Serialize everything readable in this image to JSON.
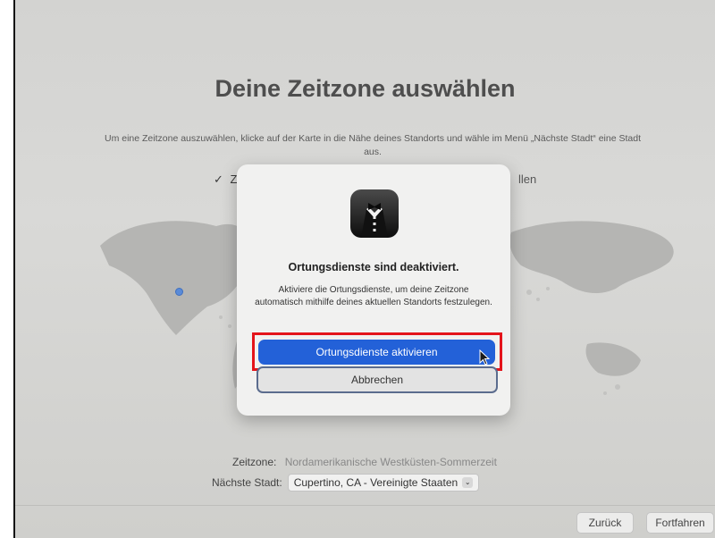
{
  "screen": {
    "title": "Deine Zeitzone auswählen",
    "subtitle": "Um eine Zeitzone auszuwählen, klicke auf der Karte in die Nähe deines Standorts und wähle im Menü „Nächste Stadt“ eine Stadt aus.",
    "auto_checkbox": {
      "checkmark": "✓",
      "visible_start": "Z",
      "visible_end": "llen"
    }
  },
  "dialog": {
    "icon": "butler-tuxedo-icon",
    "title": "Ortungsdienste sind deaktiviert.",
    "message": "Aktiviere die Ortungsdienste, um deine Zeitzone automatisch mithilfe deines aktuellen Standorts festzulegen.",
    "primary_button": "Ortungsdienste aktivieren",
    "secondary_button": "Abbrechen"
  },
  "timezone": {
    "label": "Zeitzone:",
    "value": "Nordamerikanische Westküsten-Sommerzeit"
  },
  "city": {
    "label": "Nächste Stadt:",
    "value": "Cupertino, CA - Vereinigte Staaten",
    "chevron": "⌄"
  },
  "footer": {
    "back": "Zurück",
    "continue": "Fortfahren"
  },
  "colors": {
    "primary_button": "#2361d8",
    "highlight_box": "#e4141b",
    "background": "#d5d5d3"
  }
}
